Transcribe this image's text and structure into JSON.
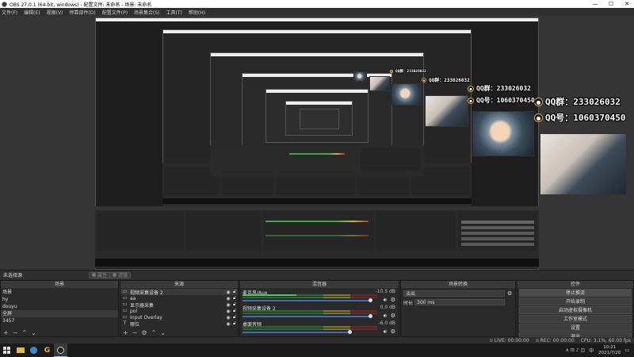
{
  "window": {
    "title": "OBS 27.0.1 (64-bit, windows) - 配置文件: 未命名 - 场景: 未命名",
    "minimize": "—",
    "maximize": "☐",
    "close": "✕"
  },
  "menu": [
    "文件(F)",
    "编辑(E)",
    "视图(V)",
    "停靠部件(D)",
    "配置文件(P)",
    "场景集合(S)",
    "工具(T)",
    "帮助(H)"
  ],
  "preview": {
    "qq_group": "QQ群：233026032",
    "qq_number": "QQ号：1060370450"
  },
  "scene_header": {
    "current": "未选择源",
    "properties": "属性",
    "filters": "滤镜"
  },
  "scenes": {
    "title": "场景",
    "items": [
      "场景",
      "hy",
      "douyu",
      "全屏",
      "3457"
    ],
    "selected_index": 3
  },
  "sources": {
    "title": "来源",
    "items": [
      {
        "icon": "▭",
        "label": "视频采集设备 2"
      },
      {
        "icon": "▭",
        "label": "aa"
      },
      {
        "icon": "▭",
        "label": "显示器采集"
      },
      {
        "icon": "▭",
        "label": "pol"
      },
      {
        "icon": "▭",
        "label": "Input Overlay"
      },
      {
        "icon": "T",
        "label": "哪位"
      }
    ]
  },
  "mixer": {
    "title": "混音器",
    "channels": [
      {
        "name": "麦克风/Aux",
        "db": "-10.5 dB",
        "level": 0.4,
        "volume": 0.95
      },
      {
        "name": "视频采集设备 2",
        "db": "0.0 dB",
        "level": 0.0,
        "volume": 0.95
      },
      {
        "name": "桌面音频",
        "db": "-6.0 dB",
        "level": 0.0,
        "volume": 0.8
      }
    ]
  },
  "transitions": {
    "title": "场景转换",
    "type": "淡出",
    "duration_label": "时长",
    "duration_value": "300 ms"
  },
  "controls": {
    "title": "控件",
    "buttons": [
      "停止推流",
      "开始录制",
      "启动虚拟摄像机",
      "工作室模式",
      "设置",
      "退出"
    ],
    "active_index": 0
  },
  "status": {
    "live": "LIVE: 00:00:00",
    "rec": "REC: 00:00:00",
    "cpu": "CPU: 3.1%, 60.00 fps"
  },
  "taskbar": {
    "time": "10:21",
    "date": "2021/7/20",
    "lang": "中",
    "tray": "∧ ⊡ ♪ ◫"
  }
}
